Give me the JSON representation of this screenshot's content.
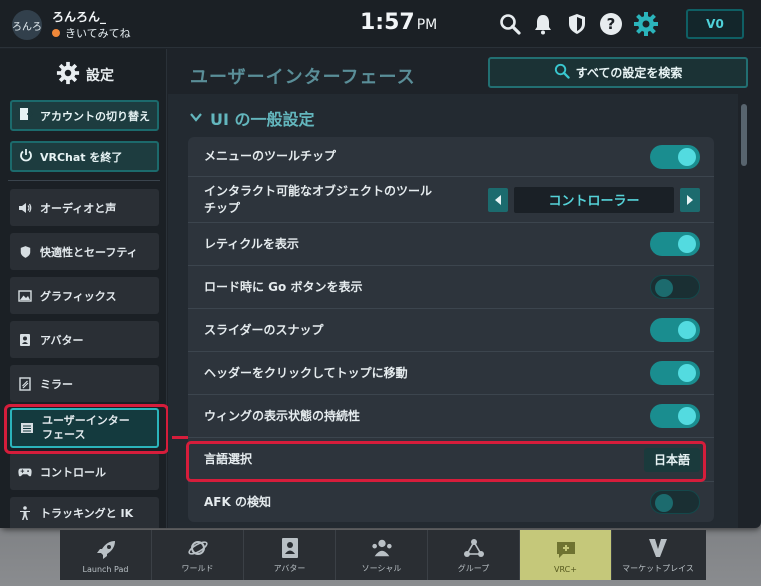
{
  "user": {
    "avatar_text": "ろんろ",
    "name": "ろんろん_",
    "status": "きいてみてね",
    "status_color": "#f0883a"
  },
  "clock": {
    "time": "1:57",
    "ampm": "PM"
  },
  "header_icons": [
    "search-icon",
    "bell-icon",
    "shield-icon",
    "help-icon",
    "gear-icon"
  ],
  "vrc_balance": "V0",
  "sidebar": {
    "title": "設定",
    "account_switch": "アカウントの切り替え",
    "quit": "VRChat を終了",
    "items": [
      {
        "label": "オーディオと声",
        "icon": "speaker-icon"
      },
      {
        "label": "快適性とセーフティ",
        "icon": "shield-icon"
      },
      {
        "label": "グラフィックス",
        "icon": "image-icon"
      },
      {
        "label": "アバター",
        "icon": "avatar-icon"
      },
      {
        "label": "ミラー",
        "icon": "mirror-icon"
      },
      {
        "label": "ユーザーインター\nフェース",
        "icon": "ui-icon",
        "active": true
      },
      {
        "label": "コントロール",
        "icon": "gamepad-icon"
      },
      {
        "label": "トラッキングと IK",
        "icon": "person-icon"
      }
    ]
  },
  "main": {
    "section_title": "ユーザーインターフェース",
    "search_all": "すべての設定を検索",
    "group_title": "UI の一般設定",
    "rows": [
      {
        "label": "メニューのツールチップ",
        "type": "toggle",
        "on": true
      },
      {
        "label": "インタラクト可能なオブジェクトのツール\nチップ",
        "type": "selector",
        "value": "コントローラー"
      },
      {
        "label": "レティクルを表示",
        "type": "toggle",
        "on": true
      },
      {
        "label": "ロード時に Go ボタンを表示",
        "type": "toggle",
        "on": false
      },
      {
        "label": "スライダーのスナップ",
        "type": "toggle",
        "on": true
      },
      {
        "label": "ヘッダーをクリックしてトップに移動",
        "type": "toggle",
        "on": true
      },
      {
        "label": "ウィングの表示状態の持続性",
        "type": "toggle",
        "on": true
      },
      {
        "label": "言語選択",
        "type": "button",
        "value": "日本語"
      },
      {
        "label": "AFK の検知",
        "type": "toggle",
        "on": false
      }
    ]
  },
  "dock": [
    {
      "label": "Launch Pad",
      "icon": "rocket-icon"
    },
    {
      "label": "ワールド",
      "icon": "planet-icon"
    },
    {
      "label": "アバター",
      "icon": "avatar-icon"
    },
    {
      "label": "ソーシャル",
      "icon": "people-icon"
    },
    {
      "label": "グループ",
      "icon": "group-icon"
    },
    {
      "label": "VRC+",
      "icon": "vrcplus-icon",
      "highlight": true
    },
    {
      "label": "マーケットプレイス",
      "icon": "v-logo-icon"
    }
  ],
  "colors": {
    "accent": "#2bb4bb",
    "highlight_red": "#d61d3b",
    "toggle_on": "#1a8d8f"
  }
}
